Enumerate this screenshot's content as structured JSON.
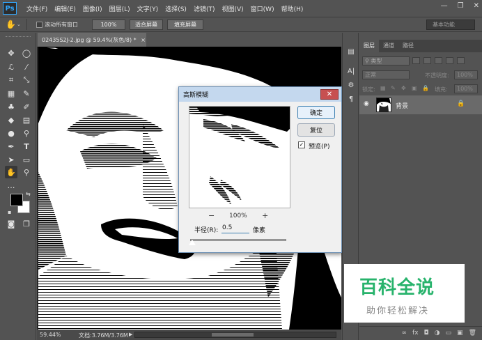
{
  "app": {
    "logo": "Ps"
  },
  "menu": [
    "文件(F)",
    "编辑(E)",
    "图像(I)",
    "图层(L)",
    "文字(Y)",
    "选择(S)",
    "滤镜(T)",
    "视图(V)",
    "窗口(W)",
    "帮助(H)"
  ],
  "window_controls": {
    "minimize": "—",
    "maximize": "❐",
    "close": "✕"
  },
  "options": {
    "scroll_all_label": "滚动所有窗口",
    "zoom_100": "100%",
    "fit_screen": "适合屏幕",
    "fill_screen": "填充屏幕",
    "workspace": "基本功能"
  },
  "document": {
    "tab_title": "02435S2J-2.jpg @ 59.4%(灰色/8) *",
    "tab_close": "×",
    "zoom": "59.44%",
    "doc_size": "文档:3.76M/3.76M"
  },
  "dialog": {
    "title": "高斯模糊",
    "close": "✕",
    "ok": "确定",
    "reset": "复位",
    "preview_label": "预览(P)",
    "preview_checked": true,
    "zoom_out_icon": "−",
    "zoom_level": "100%",
    "zoom_in_icon": "+",
    "radius_label": "半径(R):",
    "radius_value": "0.5",
    "radius_unit": "像素",
    "radius_slider_fraction": 0.02
  },
  "panel": {
    "tabs": [
      "图层",
      "通道",
      "路径"
    ],
    "filter_label": "类型",
    "blend_mode": "正常",
    "opacity_label": "不透明度:",
    "opacity_value": "100%",
    "lock_label": "锁定:",
    "fill_label": "填充:",
    "fill_value": "100%",
    "layer_name": "背景",
    "bottom_icons": [
      "∞",
      "fx",
      "◘",
      "◑",
      "▭",
      "▣",
      "🗑"
    ]
  },
  "watermark": {
    "title": "百科全说",
    "subtitle": "助你轻松解决"
  },
  "colors": {
    "ui_bg": "#535353",
    "accent": "#31a8ff",
    "watermark_green": "#28b36c"
  }
}
